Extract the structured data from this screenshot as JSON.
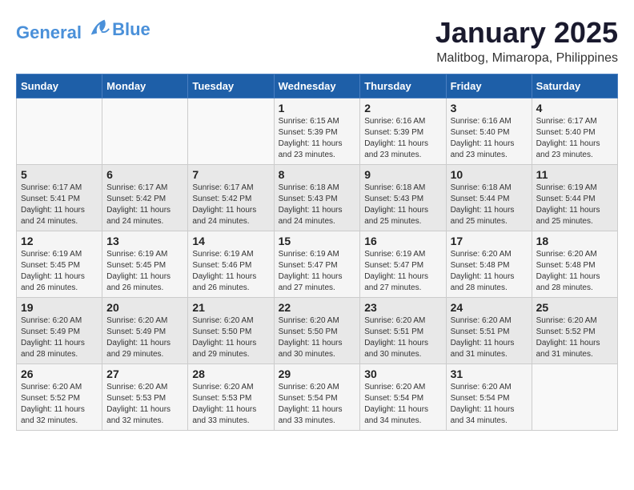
{
  "logo": {
    "line1": "General",
    "line2": "Blue"
  },
  "title": "January 2025",
  "subtitle": "Malitbog, Mimaropa, Philippines",
  "days_of_week": [
    "Sunday",
    "Monday",
    "Tuesday",
    "Wednesday",
    "Thursday",
    "Friday",
    "Saturday"
  ],
  "weeks": [
    [
      {
        "day": "",
        "info": ""
      },
      {
        "day": "",
        "info": ""
      },
      {
        "day": "",
        "info": ""
      },
      {
        "day": "1",
        "info": "Sunrise: 6:15 AM\nSunset: 5:39 PM\nDaylight: 11 hours and 23 minutes."
      },
      {
        "day": "2",
        "info": "Sunrise: 6:16 AM\nSunset: 5:39 PM\nDaylight: 11 hours and 23 minutes."
      },
      {
        "day": "3",
        "info": "Sunrise: 6:16 AM\nSunset: 5:40 PM\nDaylight: 11 hours and 23 minutes."
      },
      {
        "day": "4",
        "info": "Sunrise: 6:17 AM\nSunset: 5:40 PM\nDaylight: 11 hours and 23 minutes."
      }
    ],
    [
      {
        "day": "5",
        "info": "Sunrise: 6:17 AM\nSunset: 5:41 PM\nDaylight: 11 hours and 24 minutes."
      },
      {
        "day": "6",
        "info": "Sunrise: 6:17 AM\nSunset: 5:42 PM\nDaylight: 11 hours and 24 minutes."
      },
      {
        "day": "7",
        "info": "Sunrise: 6:17 AM\nSunset: 5:42 PM\nDaylight: 11 hours and 24 minutes."
      },
      {
        "day": "8",
        "info": "Sunrise: 6:18 AM\nSunset: 5:43 PM\nDaylight: 11 hours and 24 minutes."
      },
      {
        "day": "9",
        "info": "Sunrise: 6:18 AM\nSunset: 5:43 PM\nDaylight: 11 hours and 25 minutes."
      },
      {
        "day": "10",
        "info": "Sunrise: 6:18 AM\nSunset: 5:44 PM\nDaylight: 11 hours and 25 minutes."
      },
      {
        "day": "11",
        "info": "Sunrise: 6:19 AM\nSunset: 5:44 PM\nDaylight: 11 hours and 25 minutes."
      }
    ],
    [
      {
        "day": "12",
        "info": "Sunrise: 6:19 AM\nSunset: 5:45 PM\nDaylight: 11 hours and 26 minutes."
      },
      {
        "day": "13",
        "info": "Sunrise: 6:19 AM\nSunset: 5:45 PM\nDaylight: 11 hours and 26 minutes."
      },
      {
        "day": "14",
        "info": "Sunrise: 6:19 AM\nSunset: 5:46 PM\nDaylight: 11 hours and 26 minutes."
      },
      {
        "day": "15",
        "info": "Sunrise: 6:19 AM\nSunset: 5:47 PM\nDaylight: 11 hours and 27 minutes."
      },
      {
        "day": "16",
        "info": "Sunrise: 6:19 AM\nSunset: 5:47 PM\nDaylight: 11 hours and 27 minutes."
      },
      {
        "day": "17",
        "info": "Sunrise: 6:20 AM\nSunset: 5:48 PM\nDaylight: 11 hours and 28 minutes."
      },
      {
        "day": "18",
        "info": "Sunrise: 6:20 AM\nSunset: 5:48 PM\nDaylight: 11 hours and 28 minutes."
      }
    ],
    [
      {
        "day": "19",
        "info": "Sunrise: 6:20 AM\nSunset: 5:49 PM\nDaylight: 11 hours and 28 minutes."
      },
      {
        "day": "20",
        "info": "Sunrise: 6:20 AM\nSunset: 5:49 PM\nDaylight: 11 hours and 29 minutes."
      },
      {
        "day": "21",
        "info": "Sunrise: 6:20 AM\nSunset: 5:50 PM\nDaylight: 11 hours and 29 minutes."
      },
      {
        "day": "22",
        "info": "Sunrise: 6:20 AM\nSunset: 5:50 PM\nDaylight: 11 hours and 30 minutes."
      },
      {
        "day": "23",
        "info": "Sunrise: 6:20 AM\nSunset: 5:51 PM\nDaylight: 11 hours and 30 minutes."
      },
      {
        "day": "24",
        "info": "Sunrise: 6:20 AM\nSunset: 5:51 PM\nDaylight: 11 hours and 31 minutes."
      },
      {
        "day": "25",
        "info": "Sunrise: 6:20 AM\nSunset: 5:52 PM\nDaylight: 11 hours and 31 minutes."
      }
    ],
    [
      {
        "day": "26",
        "info": "Sunrise: 6:20 AM\nSunset: 5:52 PM\nDaylight: 11 hours and 32 minutes."
      },
      {
        "day": "27",
        "info": "Sunrise: 6:20 AM\nSunset: 5:53 PM\nDaylight: 11 hours and 32 minutes."
      },
      {
        "day": "28",
        "info": "Sunrise: 6:20 AM\nSunset: 5:53 PM\nDaylight: 11 hours and 33 minutes."
      },
      {
        "day": "29",
        "info": "Sunrise: 6:20 AM\nSunset: 5:54 PM\nDaylight: 11 hours and 33 minutes."
      },
      {
        "day": "30",
        "info": "Sunrise: 6:20 AM\nSunset: 5:54 PM\nDaylight: 11 hours and 34 minutes."
      },
      {
        "day": "31",
        "info": "Sunrise: 6:20 AM\nSunset: 5:54 PM\nDaylight: 11 hours and 34 minutes."
      },
      {
        "day": "",
        "info": ""
      }
    ]
  ]
}
